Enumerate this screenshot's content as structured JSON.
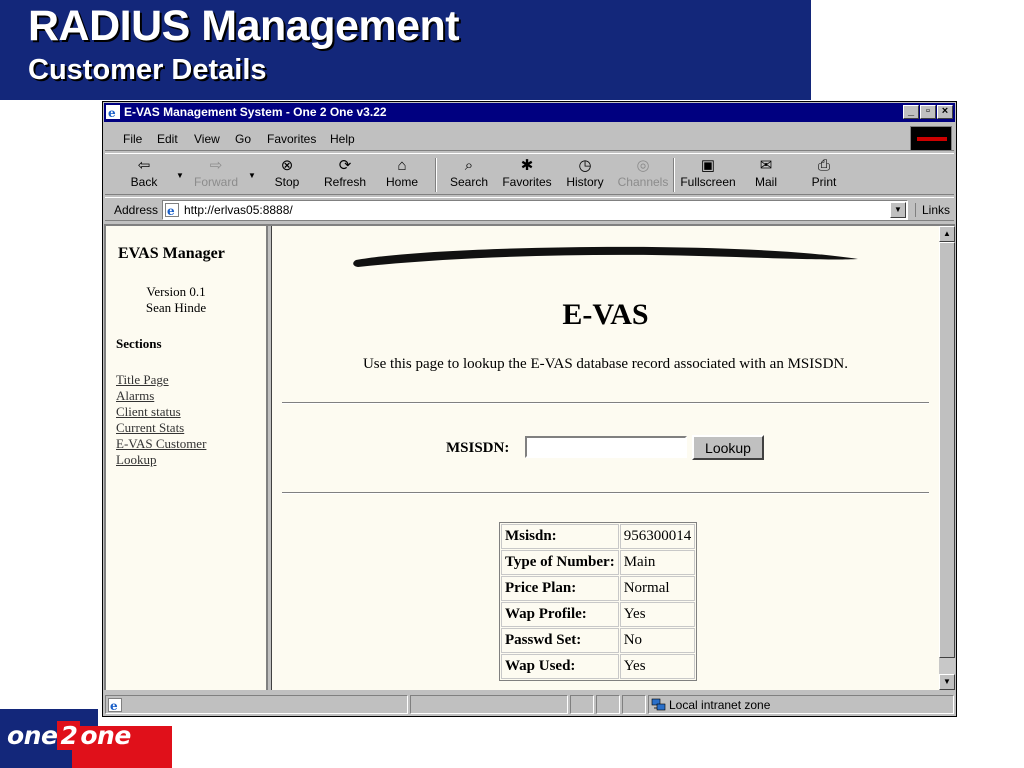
{
  "slide": {
    "title": "RADIUS Management",
    "subtitle": "Customer Details"
  },
  "browser": {
    "title": "E-VAS Management System - One 2 One v3.22",
    "window_buttons": [
      "_",
      "▫",
      "×"
    ],
    "menu": [
      "File",
      "Edit",
      "View",
      "Go",
      "Favorites",
      "Help"
    ],
    "toolbar": [
      {
        "label": "Back",
        "icon": "back-arrow-icon",
        "glyph": "⇦",
        "enabled": true
      },
      {
        "label": "Forward",
        "icon": "forward-arrow-icon",
        "glyph": "⇨",
        "enabled": false
      },
      {
        "label": "Stop",
        "icon": "stop-icon",
        "glyph": "⊗",
        "enabled": true
      },
      {
        "label": "Refresh",
        "icon": "refresh-icon",
        "glyph": "⟳",
        "enabled": true
      },
      {
        "label": "Home",
        "icon": "home-icon",
        "glyph": "⌂",
        "enabled": true
      },
      {
        "label": "Search",
        "icon": "search-icon",
        "glyph": "⌕",
        "enabled": true
      },
      {
        "label": "Favorites",
        "icon": "favorites-icon",
        "glyph": "✱",
        "enabled": true
      },
      {
        "label": "History",
        "icon": "history-icon",
        "glyph": "◷",
        "enabled": true
      },
      {
        "label": "Channels",
        "icon": "channels-icon",
        "glyph": "◎",
        "enabled": false
      },
      {
        "label": "Fullscreen",
        "icon": "fullscreen-icon",
        "glyph": "▣",
        "enabled": true
      },
      {
        "label": "Mail",
        "icon": "mail-icon",
        "glyph": "✉",
        "enabled": true
      },
      {
        "label": "Print",
        "icon": "print-icon",
        "glyph": "⎙",
        "enabled": true
      }
    ],
    "address_label": "Address",
    "address_url": "http://erlvas05:8888/",
    "links_label": "Links",
    "status_zone": "Local intranet zone"
  },
  "sidebar": {
    "app_name": "EVAS Manager",
    "version": "Version 0.1",
    "author": "Sean Hinde",
    "sections_heading": "Sections",
    "links": [
      "Title Page",
      "Alarms",
      "Client status",
      "Current Stats",
      "E-VAS Customer",
      "Lookup"
    ]
  },
  "main": {
    "heading": "E-VAS",
    "intro": "Use this page to lookup the E-VAS database record associated with an MSISDN.",
    "msisdn_label": "MSISDN:",
    "msisdn_value": "",
    "lookup_button": "Lookup",
    "record": [
      {
        "key": "Msisdn:",
        "value": "956300014"
      },
      {
        "key": "Type of Number:",
        "value": "Main"
      },
      {
        "key": "Price Plan:",
        "value": "Normal"
      },
      {
        "key": "Wap Profile:",
        "value": "Yes"
      },
      {
        "key": "Passwd Set:",
        "value": "No"
      },
      {
        "key": "Wap Used:",
        "value": "Yes"
      }
    ]
  },
  "logo": {
    "word1": "one",
    "digit": "2",
    "word2": "one"
  },
  "colors": {
    "slide_header": "#13277a",
    "titlebar": "#000080",
    "logo_red": "#e0101a",
    "page_bg": "#fdfbf1"
  }
}
